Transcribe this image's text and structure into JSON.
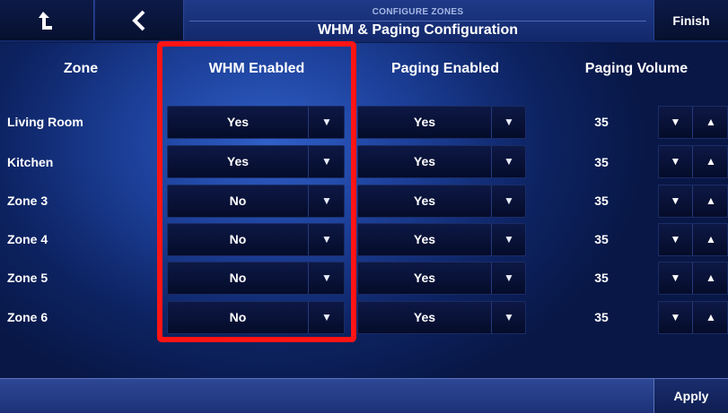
{
  "topbar": {
    "home_icon": "home-up-arrow-icon",
    "back_icon": "chevron-left-icon",
    "subtitle": "CONFIGURE ZONES",
    "title": "WHM & Paging Configuration",
    "finish_label": "Finish"
  },
  "headers": {
    "zone": "Zone",
    "whm_enabled": "WHM Enabled",
    "paging_enabled": "Paging Enabled",
    "paging_volume": "Paging Volume"
  },
  "rows": [
    {
      "zone": "Living Room",
      "whm": "Yes",
      "paging": "Yes",
      "volume": "35"
    },
    {
      "zone": "Kitchen",
      "whm": "Yes",
      "paging": "Yes",
      "volume": "35"
    },
    {
      "zone": "Zone 3",
      "whm": "No",
      "paging": "Yes",
      "volume": "35"
    },
    {
      "zone": "Zone 4",
      "whm": "No",
      "paging": "Yes",
      "volume": "35"
    },
    {
      "zone": "Zone 5",
      "whm": "No",
      "paging": "Yes",
      "volume": "35"
    },
    {
      "zone": "Zone 6",
      "whm": "No",
      "paging": "Yes",
      "volume": "35"
    }
  ],
  "bottombar": {
    "apply_label": "Apply"
  },
  "colors": {
    "highlight": "#ff1414",
    "background": "#1c3f98"
  }
}
